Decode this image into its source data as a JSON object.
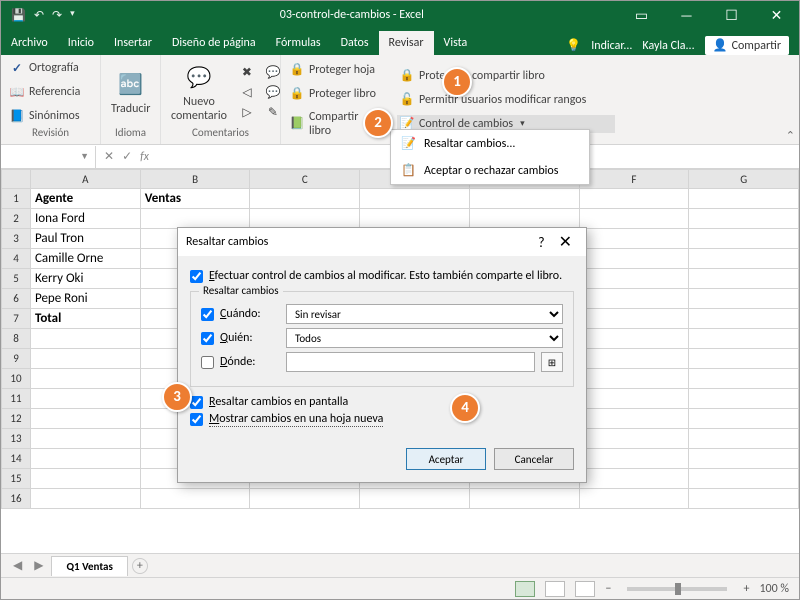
{
  "titlebar": {
    "title": "03-control-de-cambios - Excel"
  },
  "menubar": {
    "tabs": [
      "Archivo",
      "Inicio",
      "Insertar",
      "Diseño de página",
      "Fórmulas",
      "Datos",
      "Revisar",
      "Vista"
    ],
    "active": "Revisar",
    "tellme": "Indicar...",
    "user": "Kayla Cla...",
    "share": "Compartir"
  },
  "ribbon": {
    "revision": {
      "label": "Revisión",
      "ortografia": "Ortografía",
      "referencia": "Referencia",
      "sinonimos": "Sinónimos"
    },
    "idioma": {
      "label": "Idioma",
      "traducir": "Traducir"
    },
    "comentarios": {
      "label": "Comentarios",
      "nuevo": "Nuevo\ncomentario"
    },
    "cambios": {
      "proteger_hoja": "Proteger hoja",
      "proteger_libro": "Proteger libro",
      "compartir_libro": "Compartir libro",
      "proteger_compartir": "Proteger y compartir libro",
      "permitir_rangos": "Permitir usuarios modificar rangos",
      "control_cambios": "Control de cambios"
    }
  },
  "dropdown": {
    "resaltar": "Resaltar cambios...",
    "aceptar": "Aceptar o rechazar cambios"
  },
  "namebox": "",
  "sheet": {
    "cols": [
      "A",
      "B",
      "C",
      "D",
      "E",
      "F",
      "G"
    ],
    "rows": [
      {
        "n": 1,
        "cells": [
          "Agente",
          "Ventas",
          "",
          "",
          "",
          "",
          ""
        ],
        "bold": true
      },
      {
        "n": 2,
        "cells": [
          "Iona Ford",
          "",
          "",
          "",
          "",
          "",
          ""
        ]
      },
      {
        "n": 3,
        "cells": [
          "Paul Tron",
          "",
          "",
          "",
          "",
          "",
          ""
        ]
      },
      {
        "n": 4,
        "cells": [
          "Camille  Orne",
          "",
          "",
          "",
          "",
          "",
          ""
        ]
      },
      {
        "n": 5,
        "cells": [
          "Kerry Oki",
          "",
          "",
          "",
          "",
          "",
          ""
        ]
      },
      {
        "n": 6,
        "cells": [
          "Pepe Roni",
          "",
          "",
          "",
          "",
          "",
          ""
        ]
      },
      {
        "n": 7,
        "cells": [
          "Total",
          "",
          "",
          "",
          "",
          "",
          ""
        ],
        "bold": true
      },
      {
        "n": 8,
        "cells": [
          "",
          "",
          "",
          "",
          "",
          "",
          ""
        ]
      },
      {
        "n": 9,
        "cells": [
          "",
          "",
          "",
          "",
          "",
          "",
          ""
        ]
      },
      {
        "n": 10,
        "cells": [
          "",
          "",
          "",
          "",
          "",
          "",
          ""
        ]
      },
      {
        "n": 11,
        "cells": [
          "",
          "",
          "",
          "",
          "",
          "",
          ""
        ]
      },
      {
        "n": 12,
        "cells": [
          "",
          "",
          "",
          "",
          "",
          "",
          ""
        ]
      },
      {
        "n": 13,
        "cells": [
          "",
          "",
          "",
          "",
          "",
          "",
          ""
        ]
      },
      {
        "n": 14,
        "cells": [
          "",
          "",
          "",
          "",
          "",
          "",
          ""
        ]
      },
      {
        "n": 15,
        "cells": [
          "",
          "",
          "",
          "",
          "",
          "",
          ""
        ]
      },
      {
        "n": 16,
        "cells": [
          "",
          "",
          "",
          "",
          "",
          "",
          ""
        ]
      }
    ],
    "tab": "Q1 Ventas"
  },
  "dialog": {
    "title": "Resaltar cambios",
    "efectuar": "Efectuar control de cambios al modificar. Esto también comparte el libro.",
    "fieldset_title": "Resaltar cambios",
    "cuando_lbl": "Cuándo:",
    "cuando_val": "Sin revisar",
    "quien_lbl": "Quién:",
    "quien_val": "Todos",
    "donde_lbl": "Dónde:",
    "donde_val": "",
    "pantalla": "Resaltar cambios en pantalla",
    "hoja": "Mostrar cambios en una hoja nueva",
    "aceptar": "Aceptar",
    "cancelar": "Cancelar"
  },
  "status": {
    "zoom": "100 %"
  },
  "callouts": {
    "1": "1",
    "2": "2",
    "3": "3",
    "4": "4"
  }
}
